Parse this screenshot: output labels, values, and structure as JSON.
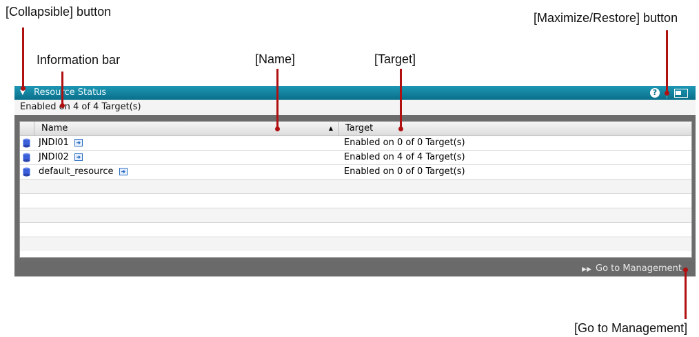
{
  "callouts": {
    "collapsible": "[Collapsible]  button",
    "maximize": "[Maximize/Restore]  button",
    "info_bar": "Information bar",
    "name": "[Name]",
    "target": "[Target]",
    "go_to_management": "[Go to Management]"
  },
  "panel": {
    "title": "Resource Status",
    "collapse_icon": "triangle-down",
    "help_icon": "?",
    "info_text": "Enabled on 4 of 4 Target(s)",
    "columns": {
      "name": "Name",
      "target": "Target",
      "sort_indicator": "▲"
    },
    "rows": [
      {
        "name": "JNDI01",
        "target": "Enabled on 0 of 0 Target(s)"
      },
      {
        "name": "JNDI02",
        "target": "Enabled on 4 of 4 Target(s)"
      },
      {
        "name": "default_resource",
        "target": "Enabled on 0 of 0 Target(s)"
      }
    ],
    "footer_link": "Go to Management",
    "footer_arrow": "▶▶"
  },
  "colors": {
    "titlebar": "#0a7f9c",
    "panel_frame": "#6c6c6c",
    "leader": "#b01010",
    "resource_icon": "#3a5fd8"
  }
}
